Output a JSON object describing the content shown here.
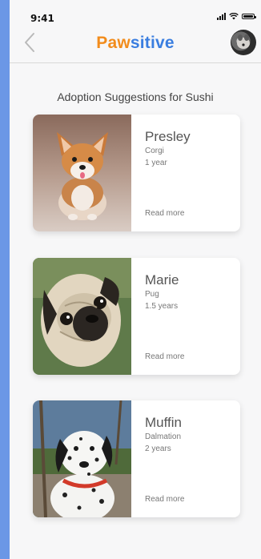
{
  "status": {
    "time": "9:41"
  },
  "header": {
    "logo_part1": "Paw",
    "logo_part2": "sitive",
    "back_icon": "chevron-left-icon",
    "avatar_icon": "user-avatar"
  },
  "section_title": "Adoption Suggestions for Sushi",
  "pets": [
    {
      "name": "Presley",
      "breed": "Corgi",
      "age": "1 year",
      "cta": "Read more"
    },
    {
      "name": "Marie",
      "breed": "Pug",
      "age": "1.5 years",
      "cta": "Read more"
    },
    {
      "name": "Muffin",
      "breed": "Dalmation",
      "age": "2 years",
      "cta": "Read more"
    }
  ],
  "colors": {
    "background": "#6b97e6",
    "logo_orange": "#f28c1c",
    "logo_blue": "#3a7ee0"
  }
}
